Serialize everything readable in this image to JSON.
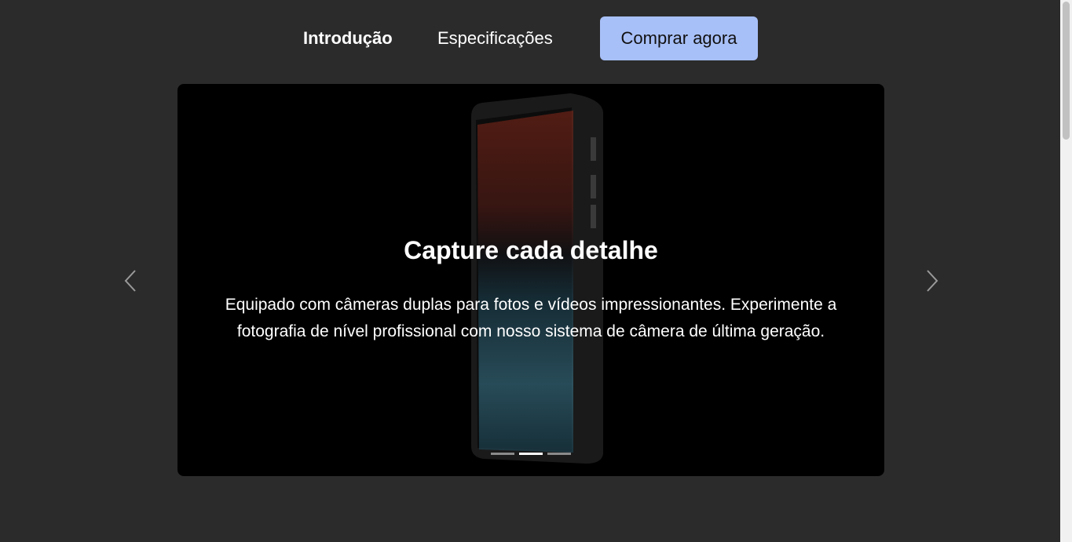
{
  "nav": {
    "intro_label": "Introdução",
    "specs_label": "Especificações",
    "buy_label": "Comprar agora"
  },
  "carousel": {
    "title": "Capture cada detalhe",
    "description": "Equipado com câmeras duplas para fotos e vídeos impressionantes. Experimente a fotografia de nível profissional com nosso sistema de câmera de última geração.",
    "slide_count": 3,
    "active_index": 1,
    "prev_icon": "chevron-left-icon",
    "next_icon": "chevron-right-icon"
  },
  "colors": {
    "page_bg": "#2b2b2b",
    "carousel_bg": "#000000",
    "buy_button_bg": "#a8c0f8",
    "text": "#ffffff"
  }
}
